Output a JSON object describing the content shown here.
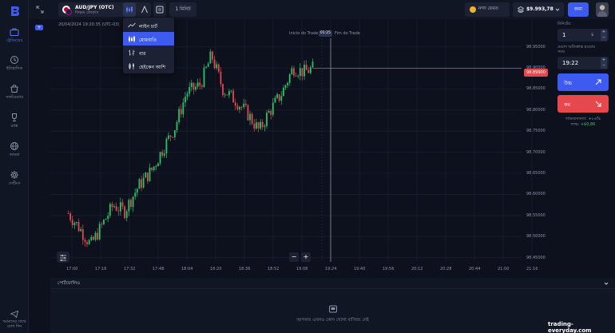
{
  "sidebar": {
    "items": [
      {
        "label": "ট্রেডিংয়ের",
        "icon": "briefcase-icon",
        "active": true
      },
      {
        "label": "ইতিহাসিক",
        "icon": "history-icon",
        "active": false
      },
      {
        "label": "সফটওয়্যার",
        "icon": "shop-icon",
        "active": false
      },
      {
        "label": "র‍্যাঙ্ক",
        "icon": "trophy-icon",
        "active": false
      },
      {
        "label": "আমরা",
        "icon": "globe-icon",
        "active": false
      },
      {
        "label": "সেটিংস",
        "icon": "gear-icon",
        "active": false
      }
    ],
    "bottom_label_1": "আমাদের সাথে",
    "bottom_label_2": "যোগ দিন",
    "badge": "+"
  },
  "topbar": {
    "asset_name": "AUD/JPY (OTC)",
    "asset_sub": "ফিক্সড ফোকাস",
    "timeframe": "1 মিনিট",
    "bonus_label": "নগদ ফেরত",
    "balance": "$9.993,78",
    "deposit_label": "জমা"
  },
  "chart_dropdown": {
    "items": [
      {
        "label": "লাইন চার্ট",
        "icon": "line-chart-icon",
        "selected": false
      },
      {
        "label": "মোমবাতি",
        "icon": "candles-icon",
        "selected": true
      },
      {
        "label": "বার",
        "icon": "bars-icon",
        "selected": false
      },
      {
        "label": "হেইকেন আশি",
        "icon": "heikin-ashi-icon",
        "selected": false
      }
    ]
  },
  "chart": {
    "date_time": "20/04/2024 19:20:35 (UTC-03)",
    "trade_start_label": "Inicio do Trade",
    "trade_end_label": "Fim do Trade",
    "trade_timer": "01:25",
    "current_price": "98.89900",
    "y_ticks": [
      "98.95000",
      "98.90000",
      "98.85000",
      "98.80000",
      "98.75000",
      "98.70000",
      "98.65000",
      "98.60000",
      "98.55000",
      "98.50000",
      "98.45000"
    ],
    "x_ticks": [
      "17:00",
      "17:16",
      "17:32",
      "17:48",
      "18:04",
      "18:20",
      "18:36",
      "18:52",
      "19:08",
      "19:24",
      "19:40",
      "19:56",
      "20:12",
      "20:28",
      "20:44",
      "21:00",
      "21:16"
    ],
    "zoom_out": "−",
    "zoom_in": "+",
    "colors": {
      "up": "#27c46b",
      "down": "#e5484d",
      "grid": "#171c2a"
    }
  },
  "chart_data": {
    "type": "candlestick",
    "ylim": [
      98.44,
      98.97
    ],
    "xlim": [
      "17:00",
      "21:16"
    ],
    "current_price": 98.899,
    "trade_end_time": "19:24",
    "x_ticks": [
      "17:00",
      "17:16",
      "17:32",
      "17:48",
      "18:04",
      "18:20",
      "18:36",
      "18:52",
      "19:08",
      "19:24",
      "19:40",
      "19:56",
      "20:12",
      "20:28",
      "20:44",
      "21:00",
      "21:16"
    ],
    "y_ticks": [
      98.95,
      98.9,
      98.85,
      98.8,
      98.75,
      98.7,
      98.65,
      98.6,
      98.55,
      98.5,
      98.45
    ]
  },
  "panel": {
    "time_label": "মিনিটের",
    "time_value": "1",
    "time_currency": "$",
    "expiry_label_1": "মেয়াদ অতিক্রান্ত হওয়ার",
    "expiry_label_2": "সময়",
    "expiry_value": "19:22",
    "up_label": "উচ্চ",
    "down_label": "কম",
    "payout_line": "লাভজনকতা: +৮৬%",
    "profit_label": "লাভ:",
    "profit_value": "+$0,86"
  },
  "bottom": {
    "header": "পোর্টফোলিও",
    "empty_text": "আপনার এখনও কোন খোলা বাণিজ্য নেই"
  },
  "watermark": "trading-everyday.com"
}
